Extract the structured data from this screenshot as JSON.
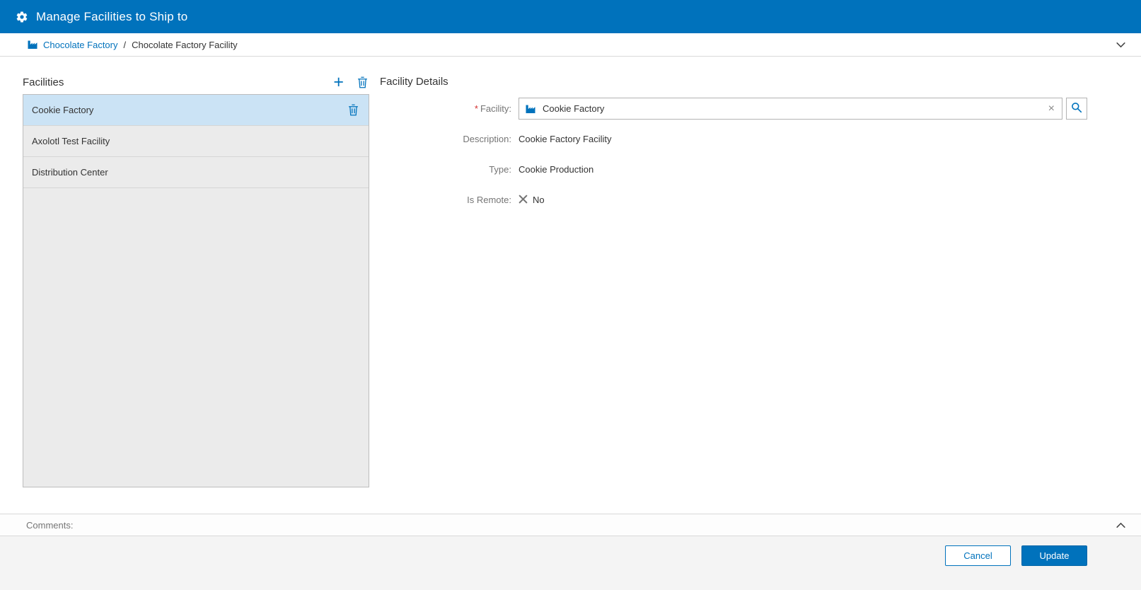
{
  "titlebar": {
    "title": "Manage Facilities to Ship to"
  },
  "breadcrumb": {
    "root": "Chocolate Factory",
    "separator": "/",
    "current": "Chocolate Factory Facility"
  },
  "facilities_panel": {
    "title": "Facilities",
    "items": [
      {
        "label": "Cookie Factory",
        "selected": true
      },
      {
        "label": "Axolotl Test Facility",
        "selected": false
      },
      {
        "label": "Distribution Center",
        "selected": false
      }
    ]
  },
  "details_panel": {
    "title": "Facility Details",
    "facility": {
      "required_marker": "*",
      "label": "Facility:",
      "value": "Cookie Factory",
      "clear_glyph": "×"
    },
    "description": {
      "label": "Description:",
      "value": "Cookie Factory Facility"
    },
    "type": {
      "label": "Type:",
      "value": "Cookie Production"
    },
    "is_remote": {
      "label": "Is Remote:",
      "value": "No"
    }
  },
  "comments": {
    "label": "Comments:"
  },
  "footer": {
    "cancel_label": "Cancel",
    "update_label": "Update"
  },
  "icons": {
    "titlebar": "gear-icon",
    "breadcrumb_entity": "factory-icon",
    "breadcrumb_collapse": "chevron-down-icon",
    "list_add": "plus-icon",
    "list_delete": "trash-icon",
    "row_delete": "trash-icon",
    "facility_field": "factory-icon",
    "facility_clear": "x-icon",
    "facility_search": "magnifier-icon",
    "is_remote_false": "x-mark-icon",
    "comments_toggle": "chevron-up-icon"
  },
  "colors": {
    "accent": "#0072BC",
    "titlebar_bg": "#0072BC",
    "selected_row_bg": "#cbe3f5",
    "list_bg": "#ebebeb",
    "required_marker": "#d32f2f"
  }
}
